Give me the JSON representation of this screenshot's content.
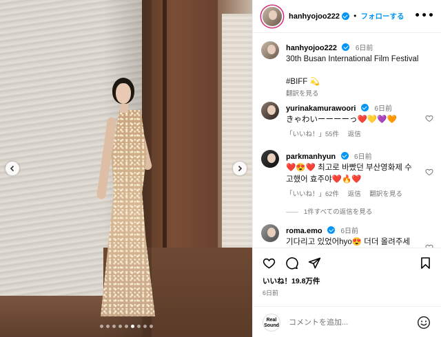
{
  "post": {
    "author": "hanhyojoo222",
    "follow_label": "フォローする",
    "separator": "•",
    "more_label": "•••"
  },
  "carousel": {
    "slide_count": 9,
    "active_index": 5
  },
  "caption": {
    "author": "hanhyojoo222",
    "time": "6日前",
    "text": "30th Busan International Film Festival",
    "hashtag": "#BIFF 💫",
    "translate": "翻訳を見る"
  },
  "comments": [
    {
      "author": "yurinakamurawoori",
      "time": "6日前",
      "text": "きゃわいーーーーっ❤️💛💜🧡",
      "likes": "「いいね！」55件",
      "reply": "返信"
    },
    {
      "author": "parkmanhyun",
      "time": "6日前",
      "text": "❤️😍❤️ 최고로 바빴던 부산영화제 수고했어 효주야❤️🔥❤️",
      "likes": "「いいね！」62件",
      "reply": "返信",
      "translate": "翻訳を見る"
    },
    {
      "author": "roma.emo",
      "time": "6日前",
      "text": "기다리고 있었어hyo😍 더더 올려주세"
    }
  ],
  "view_replies": "1件すべての返信を見る",
  "likes_total": "いいね！19.8万件",
  "posted_ago": "6日前",
  "composer": {
    "placeholder": "コメントを追加...",
    "avatar_text": "Real Sound"
  },
  "colors": {
    "accent": "#0095f6",
    "hashtag": "#3d5ff2",
    "muted": "#737373"
  }
}
